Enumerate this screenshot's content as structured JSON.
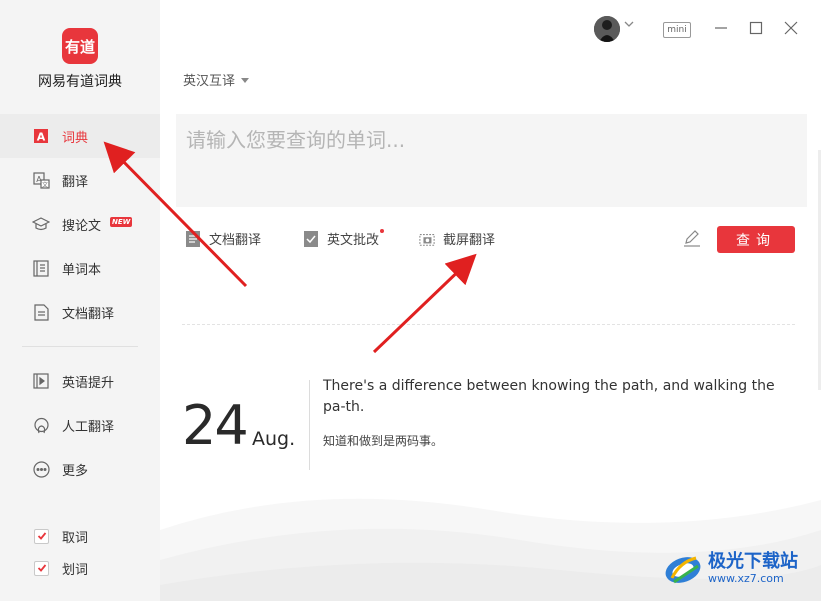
{
  "app": {
    "logo_text": "有道",
    "name": "网易有道词典"
  },
  "sidebar": {
    "items": [
      {
        "label": "词典",
        "icon": "dictionary-icon",
        "active": true
      },
      {
        "label": "翻译",
        "icon": "translate-icon"
      },
      {
        "label": "搜论文",
        "icon": "graduation-cap-icon",
        "badge": "NEW"
      },
      {
        "label": "单词本",
        "icon": "wordbook-icon"
      },
      {
        "label": "文档翻译",
        "icon": "document-icon"
      },
      {
        "label": "英语提升",
        "icon": "video-play-icon"
      },
      {
        "label": "人工翻译",
        "icon": "headset-icon"
      },
      {
        "label": "更多",
        "icon": "more-icon"
      }
    ],
    "checks": [
      {
        "label": "取词",
        "checked": true
      },
      {
        "label": "划词",
        "checked": true
      }
    ]
  },
  "topbar": {
    "mini_label": "mini"
  },
  "search": {
    "lang_label": "英汉互译",
    "placeholder": "请输入您要查询的单词...",
    "query_label": "查询"
  },
  "tools": [
    {
      "label": "文档翻译",
      "icon": "document-translate-icon"
    },
    {
      "label": "英文批改",
      "icon": "essay-correct-icon",
      "dot": true
    },
    {
      "label": "截屏翻译",
      "icon": "screenshot-translate-icon"
    }
  ],
  "daily": {
    "day": "24",
    "month": "Aug.",
    "quote_en": "There's a difference between knowing the path, and walking the pa-th.",
    "quote_cn": "知道和做到是两码事。"
  },
  "watermark": {
    "title": "极光下载站",
    "url": "www.xz7.com"
  },
  "colors": {
    "accent": "#e8363c",
    "sidebar_bg": "#f4f4f4",
    "watermark": "#1d64c8"
  }
}
